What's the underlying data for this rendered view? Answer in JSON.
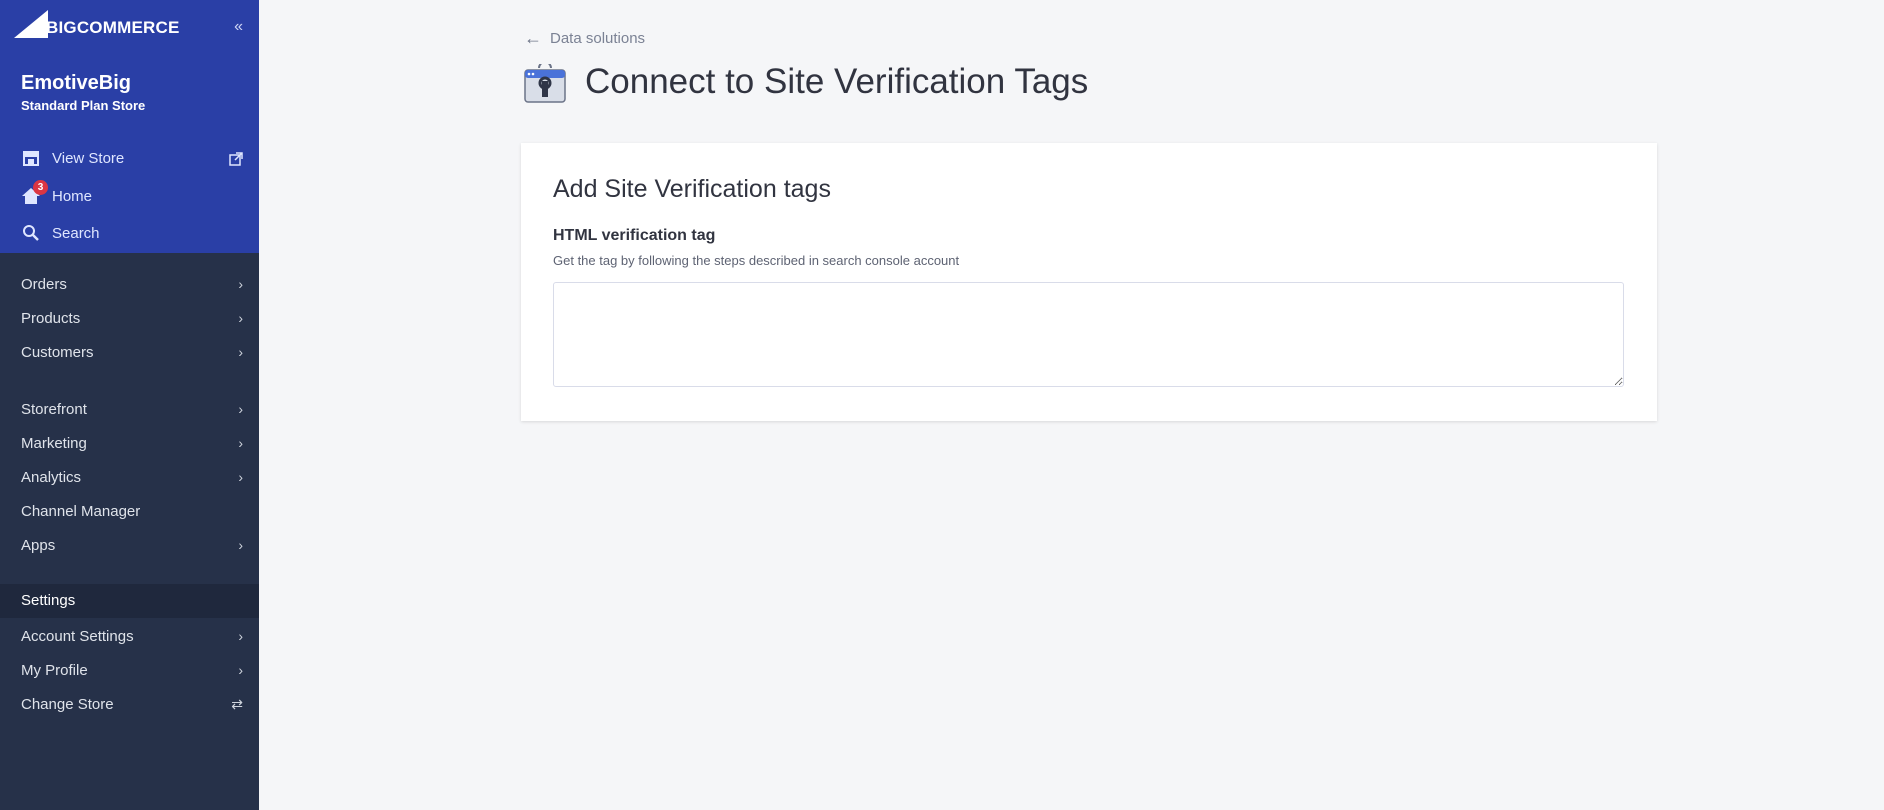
{
  "app": {
    "logo_text": "BIGCOMMERCE",
    "store_name": "EmotiveBig",
    "plan": "Standard Plan Store"
  },
  "sidebar": {
    "top_items": [
      {
        "label": "View Store",
        "icon": "storefront-icon"
      },
      {
        "label": "Home",
        "icon": "home-icon",
        "badge": "3"
      },
      {
        "label": "Search",
        "icon": "search-icon"
      }
    ],
    "nav_group1": [
      {
        "label": "Orders"
      },
      {
        "label": "Products"
      },
      {
        "label": "Customers"
      }
    ],
    "nav_group2": [
      {
        "label": "Storefront"
      },
      {
        "label": "Marketing"
      },
      {
        "label": "Analytics"
      },
      {
        "label": "Channel Manager"
      },
      {
        "label": "Apps"
      }
    ],
    "settings_label": "Settings",
    "nav_group3": [
      {
        "label": "Account Settings"
      },
      {
        "label": "My Profile"
      },
      {
        "label": "Change Store"
      }
    ]
  },
  "header": {
    "back_label": "Data solutions",
    "title": "Connect to Site Verification Tags"
  },
  "card": {
    "title": "Add Site Verification tags",
    "field_label": "HTML verification tag",
    "field_help": "Get the tag by following the steps described in search console account",
    "field_value": ""
  },
  "colors": {
    "sidebar_top": "#2a3fa6",
    "sidebar_bg": "#263149",
    "badge": "#db3643",
    "page_bg": "#f5f6f8"
  }
}
